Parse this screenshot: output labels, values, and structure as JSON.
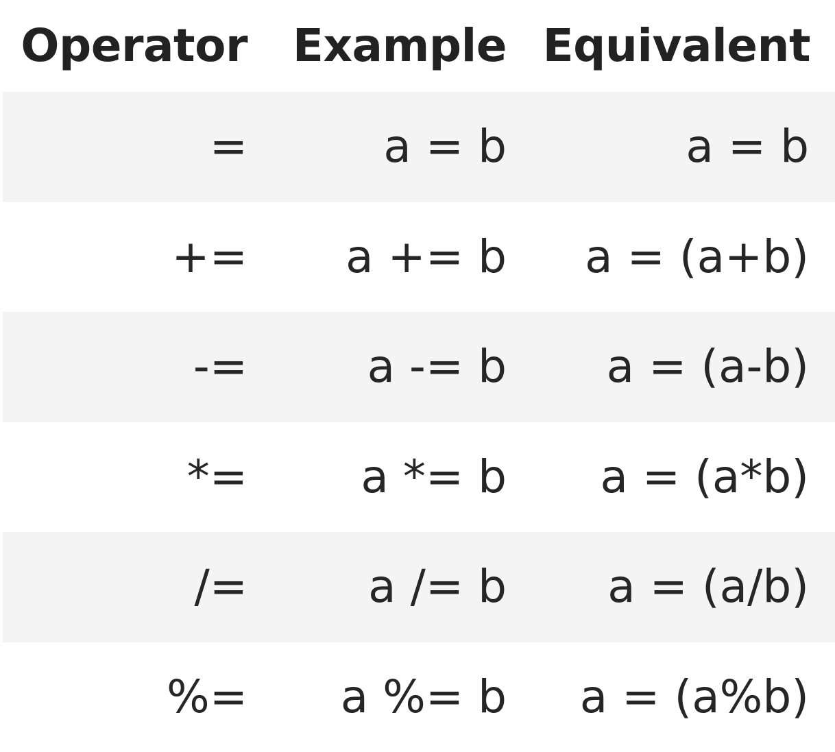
{
  "table": {
    "headers": {
      "operator": "Operator",
      "example": "Example",
      "equivalent": "Equivalent"
    },
    "rows": [
      {
        "operator": "=",
        "example": "a = b",
        "equivalent": "a = b"
      },
      {
        "operator": "+=",
        "example": "a += b",
        "equivalent": "a = (a+b)"
      },
      {
        "operator": "-=",
        "example": "a -= b",
        "equivalent": "a = (a-b)"
      },
      {
        "operator": "*=",
        "example": "a *= b",
        "equivalent": "a = (a*b)"
      },
      {
        "operator": "/=",
        "example": "a /= b",
        "equivalent": "a = (a/b)"
      },
      {
        "operator": "%=",
        "example": "a %= b",
        "equivalent": "a = (a%b)"
      }
    ]
  },
  "colors": {
    "text": "#262626",
    "stripe": "#f4f4f4",
    "background": "#ffffff"
  }
}
